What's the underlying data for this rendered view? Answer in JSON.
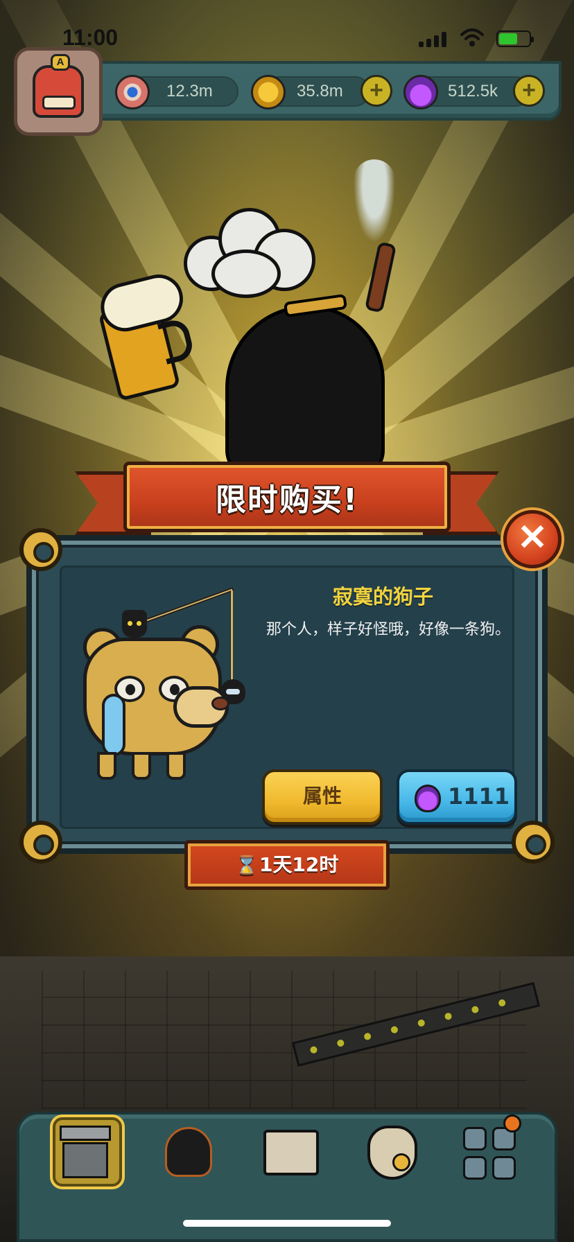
{
  "status_bar": {
    "time": "11:00"
  },
  "resources": [
    {
      "name": "eyeballs",
      "value": "12.3m",
      "icon": "eyeball-icon"
    },
    {
      "name": "coins",
      "value": "35.8m",
      "icon": "coin-icon"
    },
    {
      "name": "potions",
      "value": "512.5k",
      "icon": "potion-icon"
    }
  ],
  "avatar": {
    "badge": "A"
  },
  "offer": {
    "banner_title": "限时购买!",
    "item_name": "寂寞的狗子",
    "item_description": "那个人，样子好怪哦，好像一条狗。",
    "attributes_button": "属性",
    "price": "1111",
    "price_currency_icon": "potion-icon",
    "timer": "1天12时",
    "close_icon": "close-icon"
  },
  "bottom_nav": [
    {
      "id": "shop",
      "icon": "shop-icon",
      "active": true
    },
    {
      "id": "monsters",
      "icon": "monster-icon",
      "active": false
    },
    {
      "id": "book",
      "icon": "book-icon",
      "active": false
    },
    {
      "id": "bag",
      "icon": "money-bag-icon",
      "active": false
    },
    {
      "id": "more",
      "icon": "grid-icon",
      "active": false
    }
  ],
  "colors": {
    "banner_red": "#c8401e",
    "item_name_yellow": "#f2d43e",
    "attr_button_yellow": "#f0b92e",
    "buy_button_blue": "#47b8e8",
    "panel_teal": "#2d4b55"
  }
}
